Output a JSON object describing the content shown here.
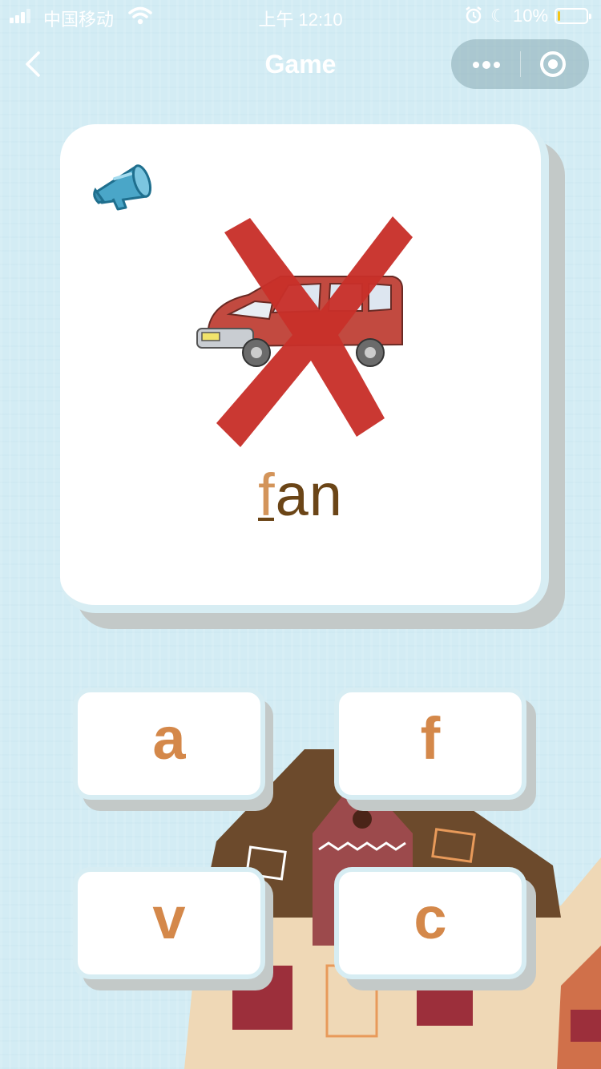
{
  "status_bar": {
    "carrier": "中国移动",
    "time": "上午 12:10",
    "battery_percent": "10%",
    "battery_level": 0.1
  },
  "nav": {
    "title": "Game"
  },
  "card": {
    "word_blank_letter": "f",
    "word_rest": "an",
    "result_mark": "wrong"
  },
  "options": [
    {
      "label": "a"
    },
    {
      "label": "f"
    },
    {
      "label": "v"
    },
    {
      "label": "c"
    }
  ],
  "colors": {
    "background": "#d3ecf4",
    "word_text": "#6b4517",
    "option_text": "#d4884a",
    "cross": "#c8302a"
  }
}
